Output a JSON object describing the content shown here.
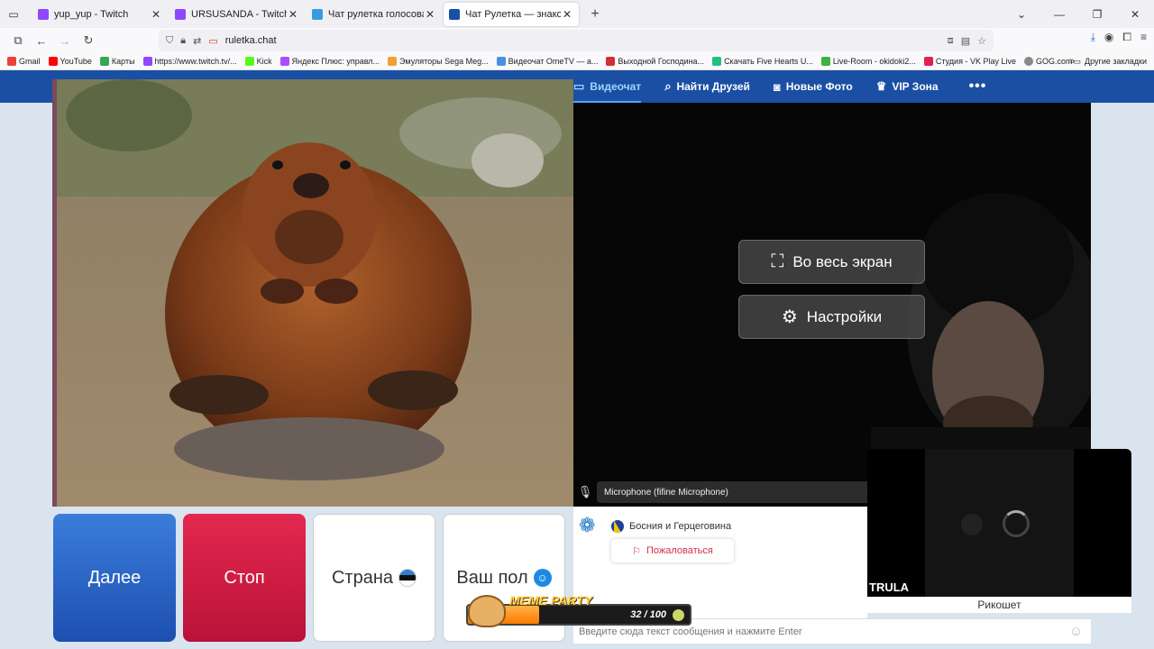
{
  "browser": {
    "tabs": [
      {
        "title": "yup_yup - Twitch",
        "favicon_color": "#9146ff",
        "active": false
      },
      {
        "title": "URSUSANDA - Twitch",
        "favicon_color": "#9146ff",
        "active": false
      },
      {
        "title": "Чат рулетка голосовая - Nekt",
        "favicon_color": "#3b9be0",
        "active": false
      },
      {
        "title": "Чат Рулетка — знакомства и о",
        "favicon_color": "#1a4fa3",
        "active": true
      }
    ],
    "new_tab": "+",
    "url": "ruletka.chat",
    "bookmarks": [
      {
        "label": "Gmail",
        "color": "#ea4335"
      },
      {
        "label": "YouTube",
        "color": "#ff0000"
      },
      {
        "label": "Карты",
        "color": "#34a853"
      },
      {
        "label": "https://www.twitch.tv/...",
        "color": "#9146ff"
      },
      {
        "label": "Kick",
        "color": "#53fc18"
      },
      {
        "label": "Яндекс Плюс: управл...",
        "color": "#b04bff"
      },
      {
        "label": "Эмуляторы Sega Meg...",
        "color": "#f0a030"
      },
      {
        "label": "Видеочат OmeTV — а...",
        "color": "#4a90e2"
      },
      {
        "label": "Выходной Господина...",
        "color": "#d03030"
      },
      {
        "label": "Скачать Five Hearts U...",
        "color": "#20c080"
      },
      {
        "label": "Live-Room - okidoki2...",
        "color": "#40b040"
      },
      {
        "label": "Студия - VK Play Live",
        "color": "#e02050"
      },
      {
        "label": "GOG.com",
        "color": "#888888"
      }
    ],
    "bookmarks_more": "»",
    "other_bookmarks": "Другие закладки"
  },
  "site": {
    "nav": [
      {
        "label": "Видеочат",
        "icon": "video-icon",
        "active": true
      },
      {
        "label": "Найти Друзей",
        "icon": "search-icon",
        "active": false
      },
      {
        "label": "Новые Фото",
        "icon": "camera-icon",
        "active": false
      },
      {
        "label": "VIP Зона",
        "icon": "crown-icon",
        "active": false
      }
    ],
    "nav_more": "•••",
    "overlay": {
      "fullscreen_label": "Во весь экран",
      "settings_label": "Настройки"
    },
    "microphone": "Microphone (fifine Microphone)",
    "buttons": {
      "next": "Далее",
      "stop": "Стоп",
      "country": "Страна",
      "gender": "Ваш пол"
    },
    "chat": {
      "partner_country": "Босния и Герцеговина",
      "report": "Пожаловаться",
      "input_placeholder": "Введите сюда текст сообщения и нажмите Enter"
    },
    "pip": {
      "brand": "TRULA",
      "caption": "Рикошет"
    },
    "meme_party": {
      "title": "MEME PARTY",
      "count": "32 / 100",
      "progress": 0.32
    }
  }
}
